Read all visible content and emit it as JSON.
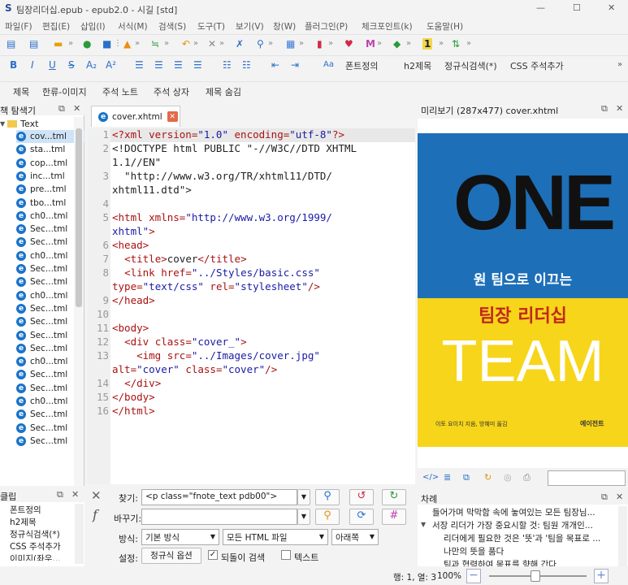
{
  "window": {
    "title": "팀장리더십.epub - epub2.0 - 시길 [std]",
    "minimize": "—",
    "maximize": "☐",
    "close": "✕"
  },
  "menu": [
    "파일(F)",
    "편집(E)",
    "삽입(I)",
    "서식(M)",
    "검색(S)",
    "도구(T)",
    "보기(V)",
    "창(W)",
    "플러그인(P)",
    "체크포인트(k)",
    "도움말(H)"
  ],
  "toolbar2": {
    "fontdef": "폰트정의",
    "h2": "h2제목",
    "regex": "정규식검색(*)",
    "css": "CSS 주석추가"
  },
  "toolbar3": [
    "제목",
    "한류-이미지",
    "주석 노트",
    "주석 상자",
    "제목 숨김"
  ],
  "browser": {
    "title": "책 탐색기",
    "root": "Text",
    "files": [
      "cov...tml",
      "sta...tml",
      "cop...tml",
      "inc...tml",
      "pre...tml",
      "tbo...tml",
      "ch0...tml",
      "Sec...tml",
      "Sec...tml",
      "ch0...tml",
      "Sec...tml",
      "Sec...tml",
      "ch0...tml",
      "Sec...tml",
      "Sec...tml",
      "Sec...tml",
      "Sec...tml",
      "ch0...tml",
      "Sec...tml",
      "Sec...tml",
      "ch0...tml",
      "Sec...tml",
      "Sec...tml",
      "Sec...tml"
    ]
  },
  "tab": {
    "label": "cover.xhtml"
  },
  "code": {
    "gutter": [
      "1",
      "2",
      "",
      "3",
      "",
      "4",
      "5",
      "",
      "6",
      "7",
      "8",
      "",
      "9",
      "10",
      "11",
      "12",
      "13",
      "",
      "14",
      "15",
      "16"
    ]
  },
  "preview": {
    "title": "미리보기 (287x477) cover.xhtml",
    "cover": {
      "one": "ONE",
      "sub": "원 팀으로 이끄는",
      "main": "팀장 리더십",
      "team": "TEAM",
      "author": "이토 요이치 지음, 방혜미 옮김",
      "publisher": "에이전트",
      "colors": {
        "top": "#1d6fb8",
        "bottom": "#f7d51a"
      }
    }
  },
  "clips": {
    "title": "클립",
    "items": [
      "폰트정의",
      "h2제목",
      "정규식검색(*)",
      "CSS 주석추가",
      "이미지(좌우..."
    ]
  },
  "find": {
    "find_label": "찾기:",
    "find_value": "<p class=\"fnote_text pdb00\">",
    "replace_label": "바꾸기:",
    "replace_value": "",
    "mode_label": "방식:",
    "mode_value": "기본 방식",
    "target_value": "모든 HTML 파일",
    "direction_value": "아래쪽",
    "settings_label": "설정:",
    "regex_btn": "정규식 옵션",
    "wrap_label": "되돌이 검색",
    "text_label": "텍스트"
  },
  "toc": {
    "title": "차례",
    "items": [
      "들어가며 막막함 속에 놓여있는 모든 팀장님...",
      "서장 리더가 가장 중요시할 것: 팀원 개개인...",
      "리더에게 필요한 것은 '뜻'과 '팀을 목표로 ...",
      "나만의 뜻을 품다",
      "팀과 협력하여 목표를 향해 간다"
    ]
  },
  "status": {
    "position": "행: 1, 열: 3",
    "zoom": "100%"
  }
}
